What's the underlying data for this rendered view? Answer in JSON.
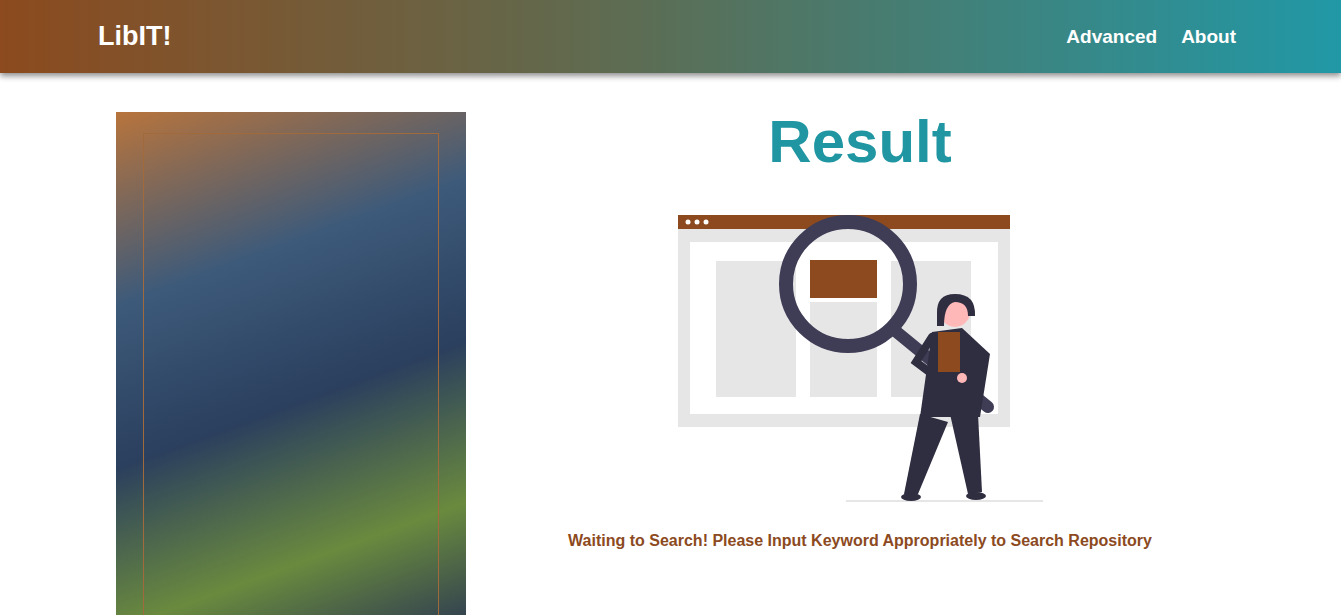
{
  "header": {
    "logo": "LibIT!",
    "nav": [
      {
        "label": "Advanced"
      },
      {
        "label": "About"
      }
    ]
  },
  "result": {
    "title": "Result",
    "message": "Waiting to Search! Please Input Keyword Appropriately to Search Repository"
  }
}
